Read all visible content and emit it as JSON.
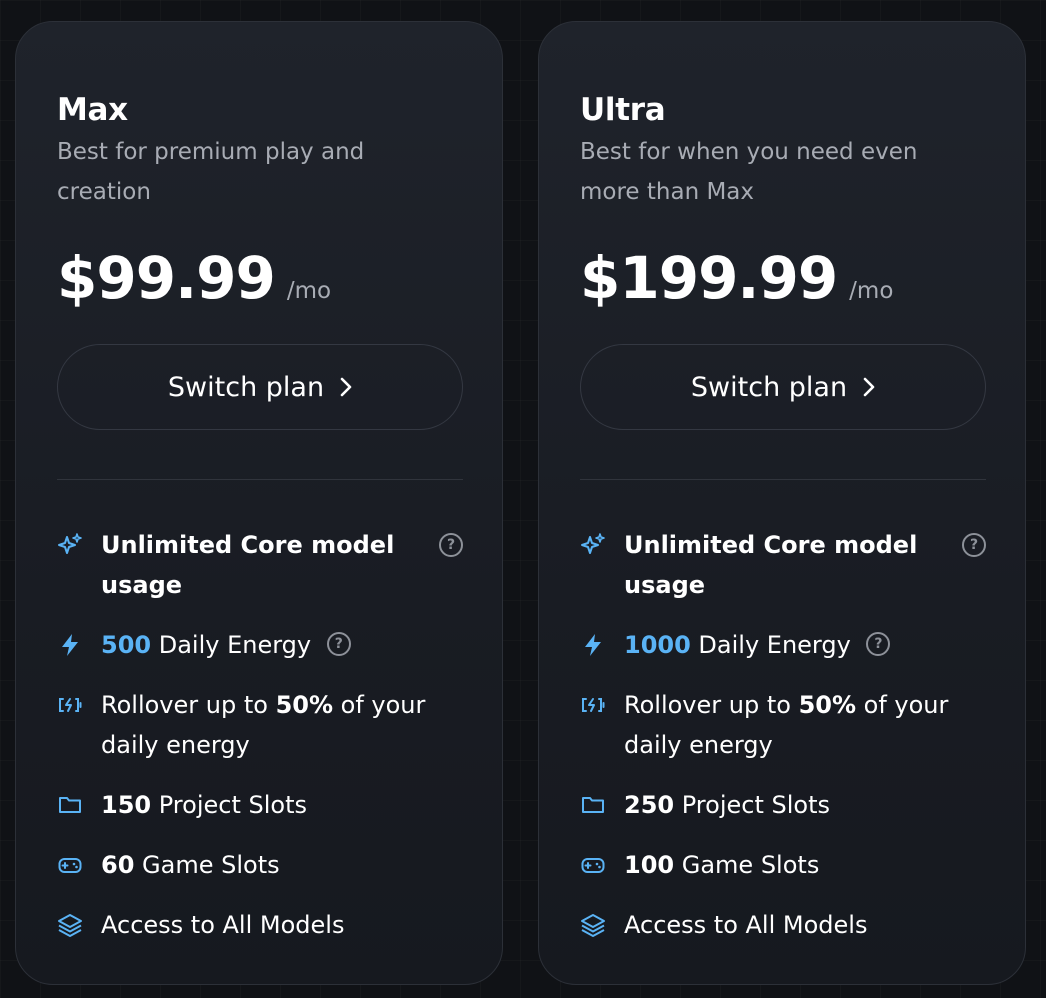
{
  "plans": [
    {
      "name": "Max",
      "description": "Best for premium play and creation",
      "price": "$99.99",
      "period": "/mo",
      "button_label": "Switch plan",
      "features": {
        "core_model": {
          "text": "Unlimited Core model usage",
          "icon": "sparkles-icon"
        },
        "energy": {
          "amount": "500",
          "text": " Daily Energy",
          "icon": "lightning-icon"
        },
        "rollover": {
          "prefix": "Rollover up to ",
          "percent": "50%",
          "suffix": " of your daily energy",
          "icon": "battery-charging-icon"
        },
        "projects": {
          "amount": "150",
          "text": " Project Slots",
          "icon": "folder-icon"
        },
        "games": {
          "amount": "60",
          "text": " Game Slots",
          "icon": "gamepad-icon"
        },
        "models": {
          "text": "Access to All Models",
          "icon": "layers-icon"
        }
      }
    },
    {
      "name": "Ultra",
      "description": "Best for when you need even more than Max",
      "price": "$199.99",
      "period": "/mo",
      "button_label": "Switch plan",
      "features": {
        "core_model": {
          "text": "Unlimited Core model usage",
          "icon": "sparkles-icon"
        },
        "energy": {
          "amount": "1000",
          "text": " Daily Energy",
          "icon": "lightning-icon"
        },
        "rollover": {
          "prefix": "Rollover up to ",
          "percent": "50%",
          "suffix": " of your daily energy",
          "icon": "battery-charging-icon"
        },
        "projects": {
          "amount": "250",
          "text": " Project Slots",
          "icon": "folder-icon"
        },
        "games": {
          "amount": "100",
          "text": " Game Slots",
          "icon": "gamepad-icon"
        },
        "models": {
          "text": "Access to All Models",
          "icon": "layers-icon"
        }
      }
    }
  ],
  "help_glyph": "?",
  "colors": {
    "accent": "#5ab3f5",
    "background": "#101216",
    "card": "#1c1f26",
    "muted": "#a8acb4"
  }
}
